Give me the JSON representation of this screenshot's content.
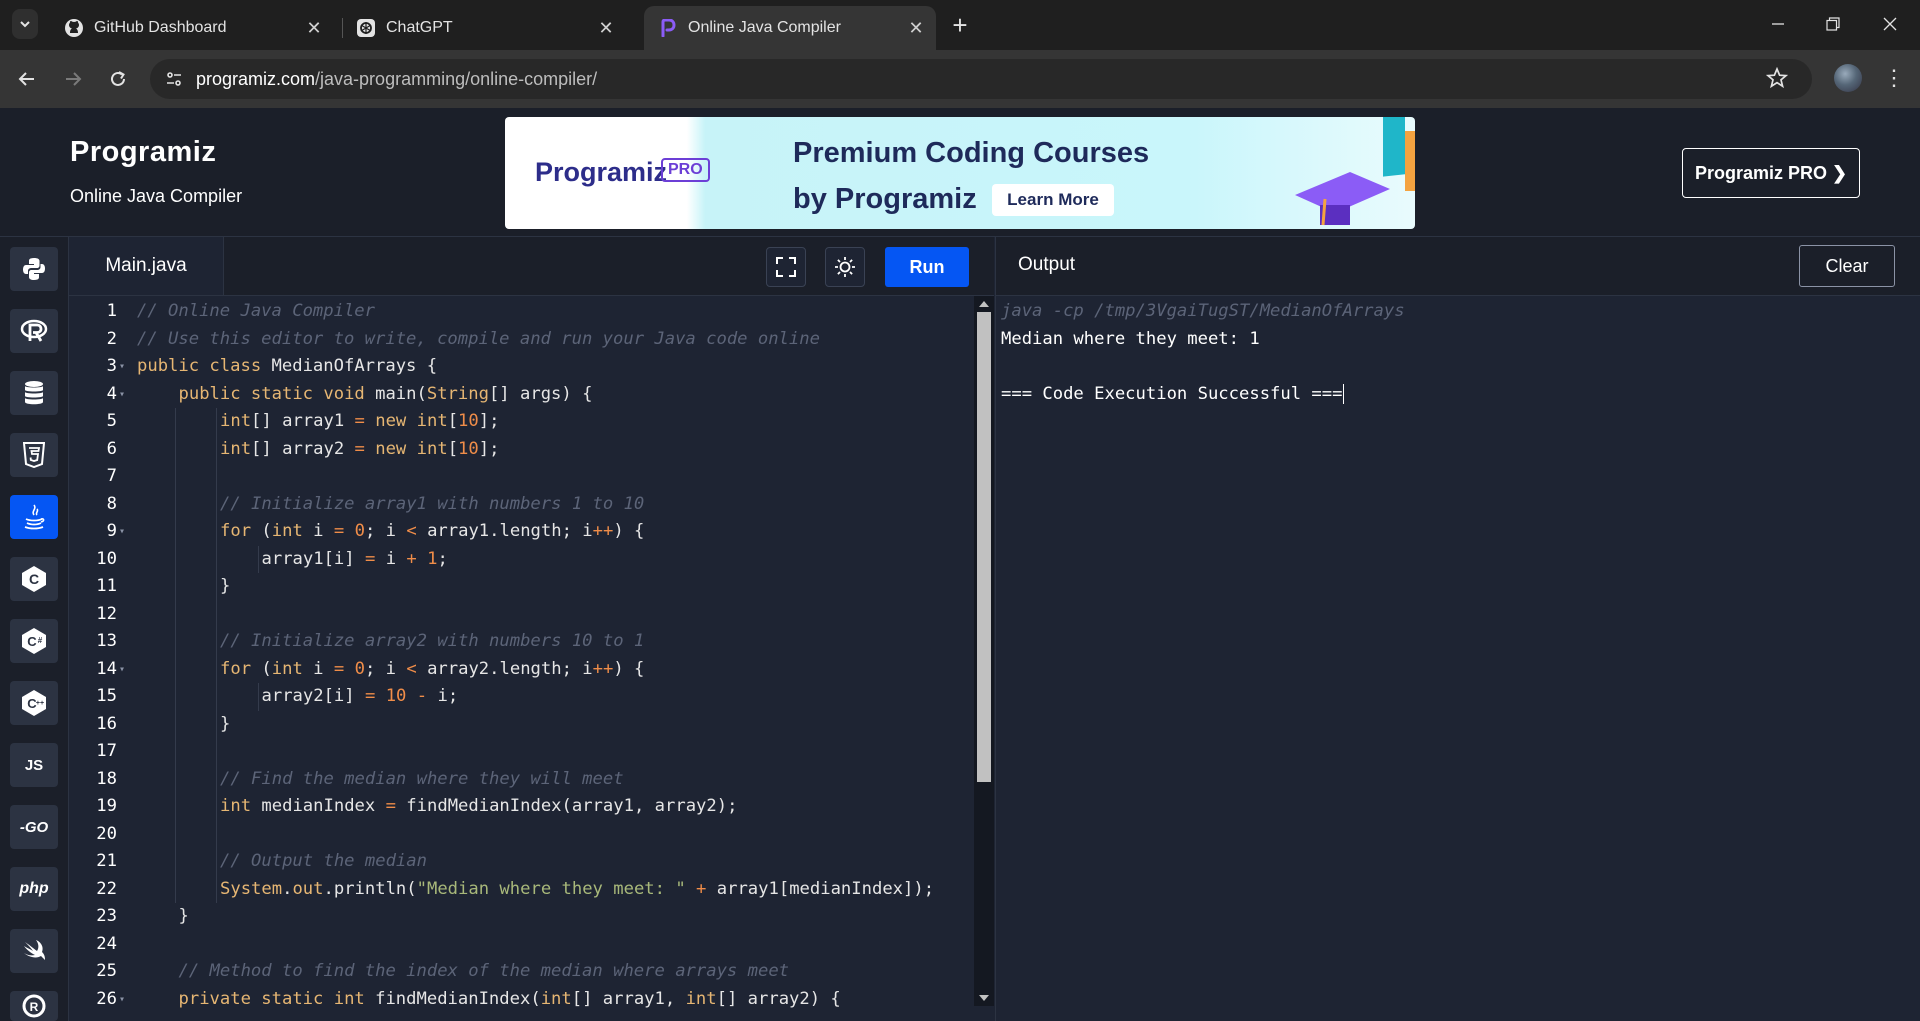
{
  "browser": {
    "tabs": [
      {
        "title": "GitHub Dashboard",
        "favicon": "github-icon"
      },
      {
        "title": "ChatGPT",
        "favicon": "chatgpt-icon"
      },
      {
        "title": "Online Java Compiler",
        "favicon": "programiz-icon",
        "active": true
      }
    ],
    "url_host": "programiz.com",
    "url_path": "/java-programming/online-compiler/"
  },
  "header": {
    "logo": "Programiz",
    "subtitle": "Online Java Compiler",
    "banner": {
      "logo_text": "Programiz",
      "pro_badge": "PRO",
      "line1": "Premium Coding Courses",
      "line2": "by Programiz",
      "cta": "Learn More"
    },
    "pro_button": "Programiz PRO ❯"
  },
  "languages": [
    {
      "name": "python",
      "icon": "python-icon"
    },
    {
      "name": "r",
      "icon": "r-icon"
    },
    {
      "name": "sql",
      "icon": "database-icon"
    },
    {
      "name": "html",
      "icon": "html5-icon"
    },
    {
      "name": "java",
      "icon": "java-icon",
      "active": true
    },
    {
      "name": "c",
      "icon": "c-icon",
      "label": "C"
    },
    {
      "name": "csharp",
      "icon": "csharp-icon",
      "label": "C#"
    },
    {
      "name": "cpp",
      "icon": "cpp-icon",
      "label": "C++"
    },
    {
      "name": "javascript",
      "icon": "js-icon",
      "label": "JS"
    },
    {
      "name": "go",
      "icon": "go-icon",
      "label": "-GO"
    },
    {
      "name": "php",
      "icon": "php-icon",
      "label": "php"
    },
    {
      "name": "swift",
      "icon": "swift-icon"
    },
    {
      "name": "rust",
      "icon": "rust-icon"
    }
  ],
  "editor": {
    "filename": "Main.java",
    "run_label": "Run",
    "lines": [
      {
        "n": "1",
        "indent": 0,
        "fold": false,
        "tokens": [
          [
            "c",
            "// Online Java Compiler"
          ]
        ]
      },
      {
        "n": "2",
        "indent": 0,
        "fold": false,
        "tokens": [
          [
            "c",
            "// Use this editor to write, compile and run your Java code online"
          ]
        ]
      },
      {
        "n": "3",
        "indent": 0,
        "fold": true,
        "tokens": [
          [
            "k",
            "public class "
          ],
          [
            "t",
            "MedianOfArrays {"
          ]
        ]
      },
      {
        "n": "4",
        "indent": 1,
        "fold": true,
        "tokens": [
          [
            "k",
            "public static void "
          ],
          [
            "t",
            "main("
          ],
          [
            "k",
            "String"
          ],
          [
            "t",
            "[] args) {"
          ]
        ]
      },
      {
        "n": "5",
        "indent": 2,
        "fold": false,
        "tokens": [
          [
            "k",
            "int"
          ],
          [
            "t",
            "[] array1 "
          ],
          [
            "op",
            "="
          ],
          [
            "k",
            " new int"
          ],
          [
            "t",
            "["
          ],
          [
            "n",
            "10"
          ],
          [
            "t",
            "];"
          ]
        ]
      },
      {
        "n": "6",
        "indent": 2,
        "fold": false,
        "tokens": [
          [
            "k",
            "int"
          ],
          [
            "t",
            "[] array2 "
          ],
          [
            "op",
            "="
          ],
          [
            "k",
            " new int"
          ],
          [
            "t",
            "["
          ],
          [
            "n",
            "10"
          ],
          [
            "t",
            "];"
          ]
        ]
      },
      {
        "n": "7",
        "indent": 2,
        "fold": false,
        "tokens": []
      },
      {
        "n": "8",
        "indent": 2,
        "fold": false,
        "tokens": [
          [
            "c",
            "// Initialize array1 with numbers 1 to 10"
          ]
        ]
      },
      {
        "n": "9",
        "indent": 2,
        "fold": true,
        "tokens": [
          [
            "k",
            "for "
          ],
          [
            "t",
            "("
          ],
          [
            "k",
            "int "
          ],
          [
            "t",
            "i "
          ],
          [
            "op",
            "="
          ],
          [
            "t",
            " "
          ],
          [
            "n",
            "0"
          ],
          [
            "t",
            "; i "
          ],
          [
            "op",
            "<"
          ],
          [
            "t",
            " array1.length; i"
          ],
          [
            "op",
            "++"
          ],
          [
            "t",
            ") {"
          ]
        ]
      },
      {
        "n": "10",
        "indent": 3,
        "fold": false,
        "tokens": [
          [
            "t",
            "array1[i] "
          ],
          [
            "op",
            "="
          ],
          [
            "t",
            " i "
          ],
          [
            "op",
            "+"
          ],
          [
            "t",
            " "
          ],
          [
            "n",
            "1"
          ],
          [
            "t",
            ";"
          ]
        ]
      },
      {
        "n": "11",
        "indent": 2,
        "fold": false,
        "tokens": [
          [
            "t",
            "}"
          ]
        ]
      },
      {
        "n": "12",
        "indent": 2,
        "fold": false,
        "tokens": []
      },
      {
        "n": "13",
        "indent": 2,
        "fold": false,
        "tokens": [
          [
            "c",
            "// Initialize array2 with numbers 10 to 1"
          ]
        ]
      },
      {
        "n": "14",
        "indent": 2,
        "fold": true,
        "tokens": [
          [
            "k",
            "for "
          ],
          [
            "t",
            "("
          ],
          [
            "k",
            "int "
          ],
          [
            "t",
            "i "
          ],
          [
            "op",
            "="
          ],
          [
            "t",
            " "
          ],
          [
            "n",
            "0"
          ],
          [
            "t",
            "; i "
          ],
          [
            "op",
            "<"
          ],
          [
            "t",
            " array2.length; i"
          ],
          [
            "op",
            "++"
          ],
          [
            "t",
            ") {"
          ]
        ]
      },
      {
        "n": "15",
        "indent": 3,
        "fold": false,
        "tokens": [
          [
            "t",
            "array2[i] "
          ],
          [
            "op",
            "="
          ],
          [
            "t",
            " "
          ],
          [
            "n",
            "10"
          ],
          [
            "t",
            " "
          ],
          [
            "op",
            "-"
          ],
          [
            "t",
            " i;"
          ]
        ]
      },
      {
        "n": "16",
        "indent": 2,
        "fold": false,
        "tokens": [
          [
            "t",
            "}"
          ]
        ]
      },
      {
        "n": "17",
        "indent": 2,
        "fold": false,
        "tokens": []
      },
      {
        "n": "18",
        "indent": 2,
        "fold": false,
        "tokens": [
          [
            "c",
            "// Find the median where they will meet"
          ]
        ]
      },
      {
        "n": "19",
        "indent": 2,
        "fold": false,
        "tokens": [
          [
            "k",
            "int "
          ],
          [
            "t",
            "medianIndex "
          ],
          [
            "op",
            "="
          ],
          [
            "t",
            " findMedianIndex(array1, array2);"
          ]
        ]
      },
      {
        "n": "20",
        "indent": 2,
        "fold": false,
        "tokens": []
      },
      {
        "n": "21",
        "indent": 2,
        "fold": false,
        "tokens": [
          [
            "c",
            "// Output the median"
          ]
        ]
      },
      {
        "n": "22",
        "indent": 2,
        "fold": false,
        "tokens": [
          [
            "k",
            "System"
          ],
          [
            "t",
            "."
          ],
          [
            "k",
            "out"
          ],
          [
            "t",
            ".println("
          ],
          [
            "s",
            "\"Median where they meet: \""
          ],
          [
            "t",
            " "
          ],
          [
            "op",
            "+"
          ],
          [
            "t",
            " array1[medianIndex]);"
          ]
        ]
      },
      {
        "n": "23",
        "indent": 1,
        "fold": false,
        "tokens": [
          [
            "t",
            "}"
          ]
        ]
      },
      {
        "n": "24",
        "indent": 1,
        "fold": false,
        "tokens": []
      },
      {
        "n": "25",
        "indent": 1,
        "fold": false,
        "tokens": [
          [
            "c",
            "// Method to find the index of the median where arrays meet"
          ]
        ]
      },
      {
        "n": "26",
        "indent": 1,
        "fold": true,
        "tokens": [
          [
            "k",
            "private static int "
          ],
          [
            "t",
            "findMedianIndex("
          ],
          [
            "k",
            "int"
          ],
          [
            "t",
            "[] array1, "
          ],
          [
            "k",
            "int"
          ],
          [
            "t",
            "[] array2) {"
          ]
        ]
      }
    ]
  },
  "output": {
    "title": "Output",
    "clear_label": "Clear",
    "lines": [
      {
        "kind": "cmd",
        "text": "java -cp /tmp/3VgaiTugST/MedianOfArrays"
      },
      {
        "kind": "out",
        "text": "Median where they meet: 1"
      },
      {
        "kind": "out",
        "text": ""
      },
      {
        "kind": "out",
        "text": "=== Code Execution Successful ==="
      }
    ]
  }
}
